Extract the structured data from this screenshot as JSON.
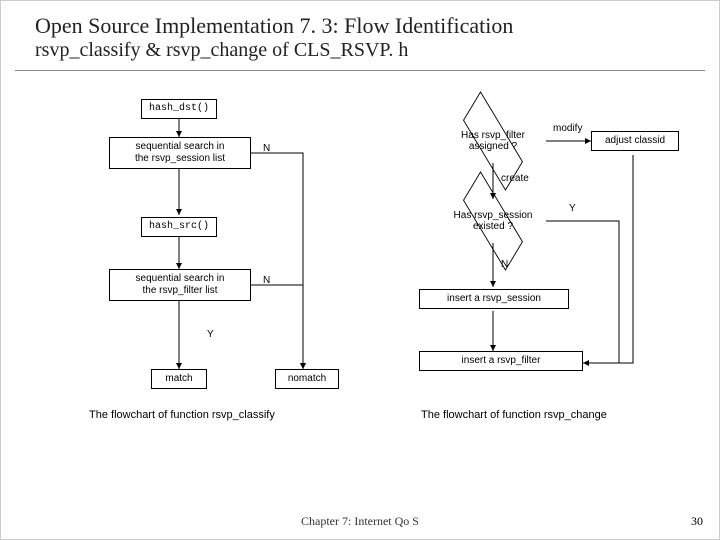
{
  "title": {
    "line1": "Open Source Implementation 7. 3: Flow Identification",
    "line2": "rsvp_classify & rsvp_change of CLS_RSVP. h"
  },
  "left": {
    "box_hash_dst": "hash_dst()",
    "box_search_session_l1": "sequential search in",
    "box_search_session_l2": "the rsvp_session list",
    "label_search_session_n": "N",
    "box_hash_src": "hash_src()",
    "box_search_filter_l1": "sequential search in",
    "box_search_filter_l2": "the rsvp_filter list",
    "label_search_filter_n": "N",
    "label_y": "Y",
    "box_match": "match",
    "box_nomatch": "nomatch",
    "caption": "The flowchart of function rsvp_classify"
  },
  "right": {
    "diamond_filter": "Has rsvp_filter assigned ?",
    "label_modify": "modify",
    "box_adjust": "adjust classid",
    "label_create": "create",
    "diamond_session": "Has rsvp_session existed ?",
    "label_session_y": "Y",
    "label_session_n": "N",
    "box_insert_session": "insert a rsvp_session",
    "box_insert_filter": "insert a rsvp_filter",
    "caption": "The flowchart of function rsvp_change"
  },
  "footer": "Chapter 7: Internet Qo S",
  "page": "30"
}
